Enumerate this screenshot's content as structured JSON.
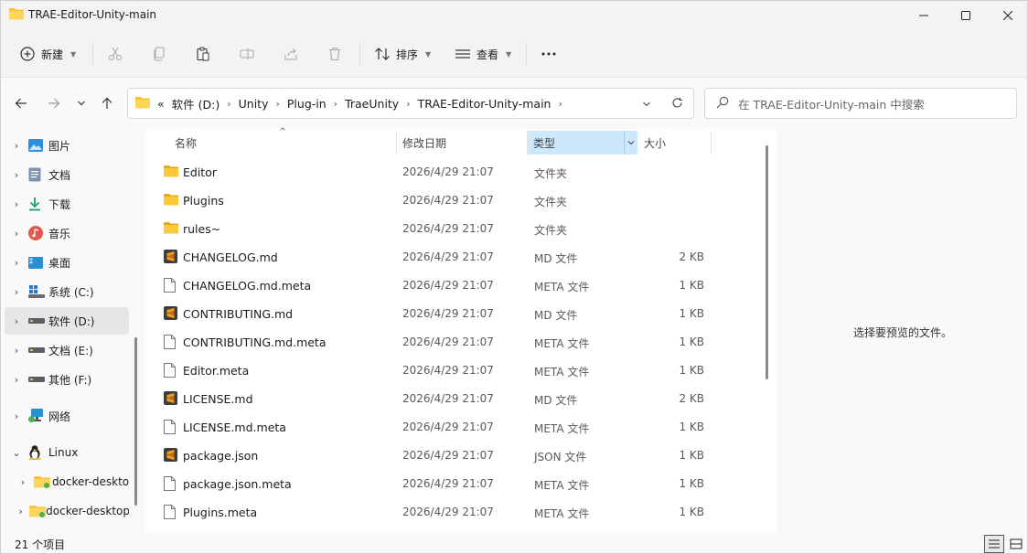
{
  "window": {
    "title": "TRAE-Editor-Unity-main"
  },
  "toolbar": {
    "new_label": "新建",
    "sort_label": "排序",
    "view_label": "查看"
  },
  "address": {
    "crumbs": [
      "软件 (D:)",
      "Unity",
      "Plug-in",
      "TraeUnity",
      "TRAE-Editor-Unity-main"
    ],
    "overflow": "«"
  },
  "search": {
    "placeholder": "在 TRAE-Editor-Unity-main 中搜索"
  },
  "sidebar": {
    "items": [
      {
        "label": "图片",
        "icon": "pictures-icon"
      },
      {
        "label": "文档",
        "icon": "documents-icon"
      },
      {
        "label": "下载",
        "icon": "downloads-icon"
      },
      {
        "label": "音乐",
        "icon": "music-icon"
      },
      {
        "label": "桌面",
        "icon": "desktop-icon"
      },
      {
        "label": "系统 (C:)",
        "icon": "windows-drive-icon"
      },
      {
        "label": "软件 (D:)",
        "icon": "drive-icon"
      },
      {
        "label": "文档 (E:)",
        "icon": "drive-icon"
      },
      {
        "label": "其他 (F:)",
        "icon": "drive-icon"
      },
      {
        "label": "网络",
        "icon": "network-icon"
      },
      {
        "label": "Linux",
        "icon": "linux-icon"
      },
      {
        "label": "docker-desktop",
        "icon": "folder-icon"
      },
      {
        "label": "docker-desktop-data",
        "icon": "folder-icon"
      }
    ]
  },
  "columns": {
    "name": "名称",
    "date": "修改日期",
    "type": "类型",
    "size": "大小"
  },
  "files": [
    {
      "name": "Editor",
      "date": "2026/4/29 21:07",
      "type": "文件夹",
      "size": "",
      "icon": "folder-icon"
    },
    {
      "name": "Plugins",
      "date": "2026/4/29 21:07",
      "type": "文件夹",
      "size": "",
      "icon": "folder-icon"
    },
    {
      "name": "rules~",
      "date": "2026/4/29 21:07",
      "type": "文件夹",
      "size": "",
      "icon": "folder-icon"
    },
    {
      "name": "CHANGELOG.md",
      "date": "2026/4/29 21:07",
      "type": "MD 文件",
      "size": "2 KB",
      "icon": "sublime-file-icon"
    },
    {
      "name": "CHANGELOG.md.meta",
      "date": "2026/4/29 21:07",
      "type": "META 文件",
      "size": "1 KB",
      "icon": "blank-file-icon"
    },
    {
      "name": "CONTRIBUTING.md",
      "date": "2026/4/29 21:07",
      "type": "MD 文件",
      "size": "1 KB",
      "icon": "sublime-file-icon"
    },
    {
      "name": "CONTRIBUTING.md.meta",
      "date": "2026/4/29 21:07",
      "type": "META 文件",
      "size": "1 KB",
      "icon": "blank-file-icon"
    },
    {
      "name": "Editor.meta",
      "date": "2026/4/29 21:07",
      "type": "META 文件",
      "size": "1 KB",
      "icon": "blank-file-icon"
    },
    {
      "name": "LICENSE.md",
      "date": "2026/4/29 21:07",
      "type": "MD 文件",
      "size": "2 KB",
      "icon": "sublime-file-icon"
    },
    {
      "name": "LICENSE.md.meta",
      "date": "2026/4/29 21:07",
      "type": "META 文件",
      "size": "1 KB",
      "icon": "blank-file-icon"
    },
    {
      "name": "package.json",
      "date": "2026/4/29 21:07",
      "type": "JSON 文件",
      "size": "1 KB",
      "icon": "sublime-file-icon"
    },
    {
      "name": "package.json.meta",
      "date": "2026/4/29 21:07",
      "type": "META 文件",
      "size": "1 KB",
      "icon": "blank-file-icon"
    },
    {
      "name": "Plugins.meta",
      "date": "2026/4/29 21:07",
      "type": "META 文件",
      "size": "1 KB",
      "icon": "blank-file-icon"
    }
  ],
  "preview": {
    "message": "选择要预览的文件。"
  },
  "status": {
    "count": "21 个项目"
  },
  "colors": {
    "accent": "#0067c0",
    "folder": "#f8c13a",
    "header_active": "#cde8fb"
  }
}
